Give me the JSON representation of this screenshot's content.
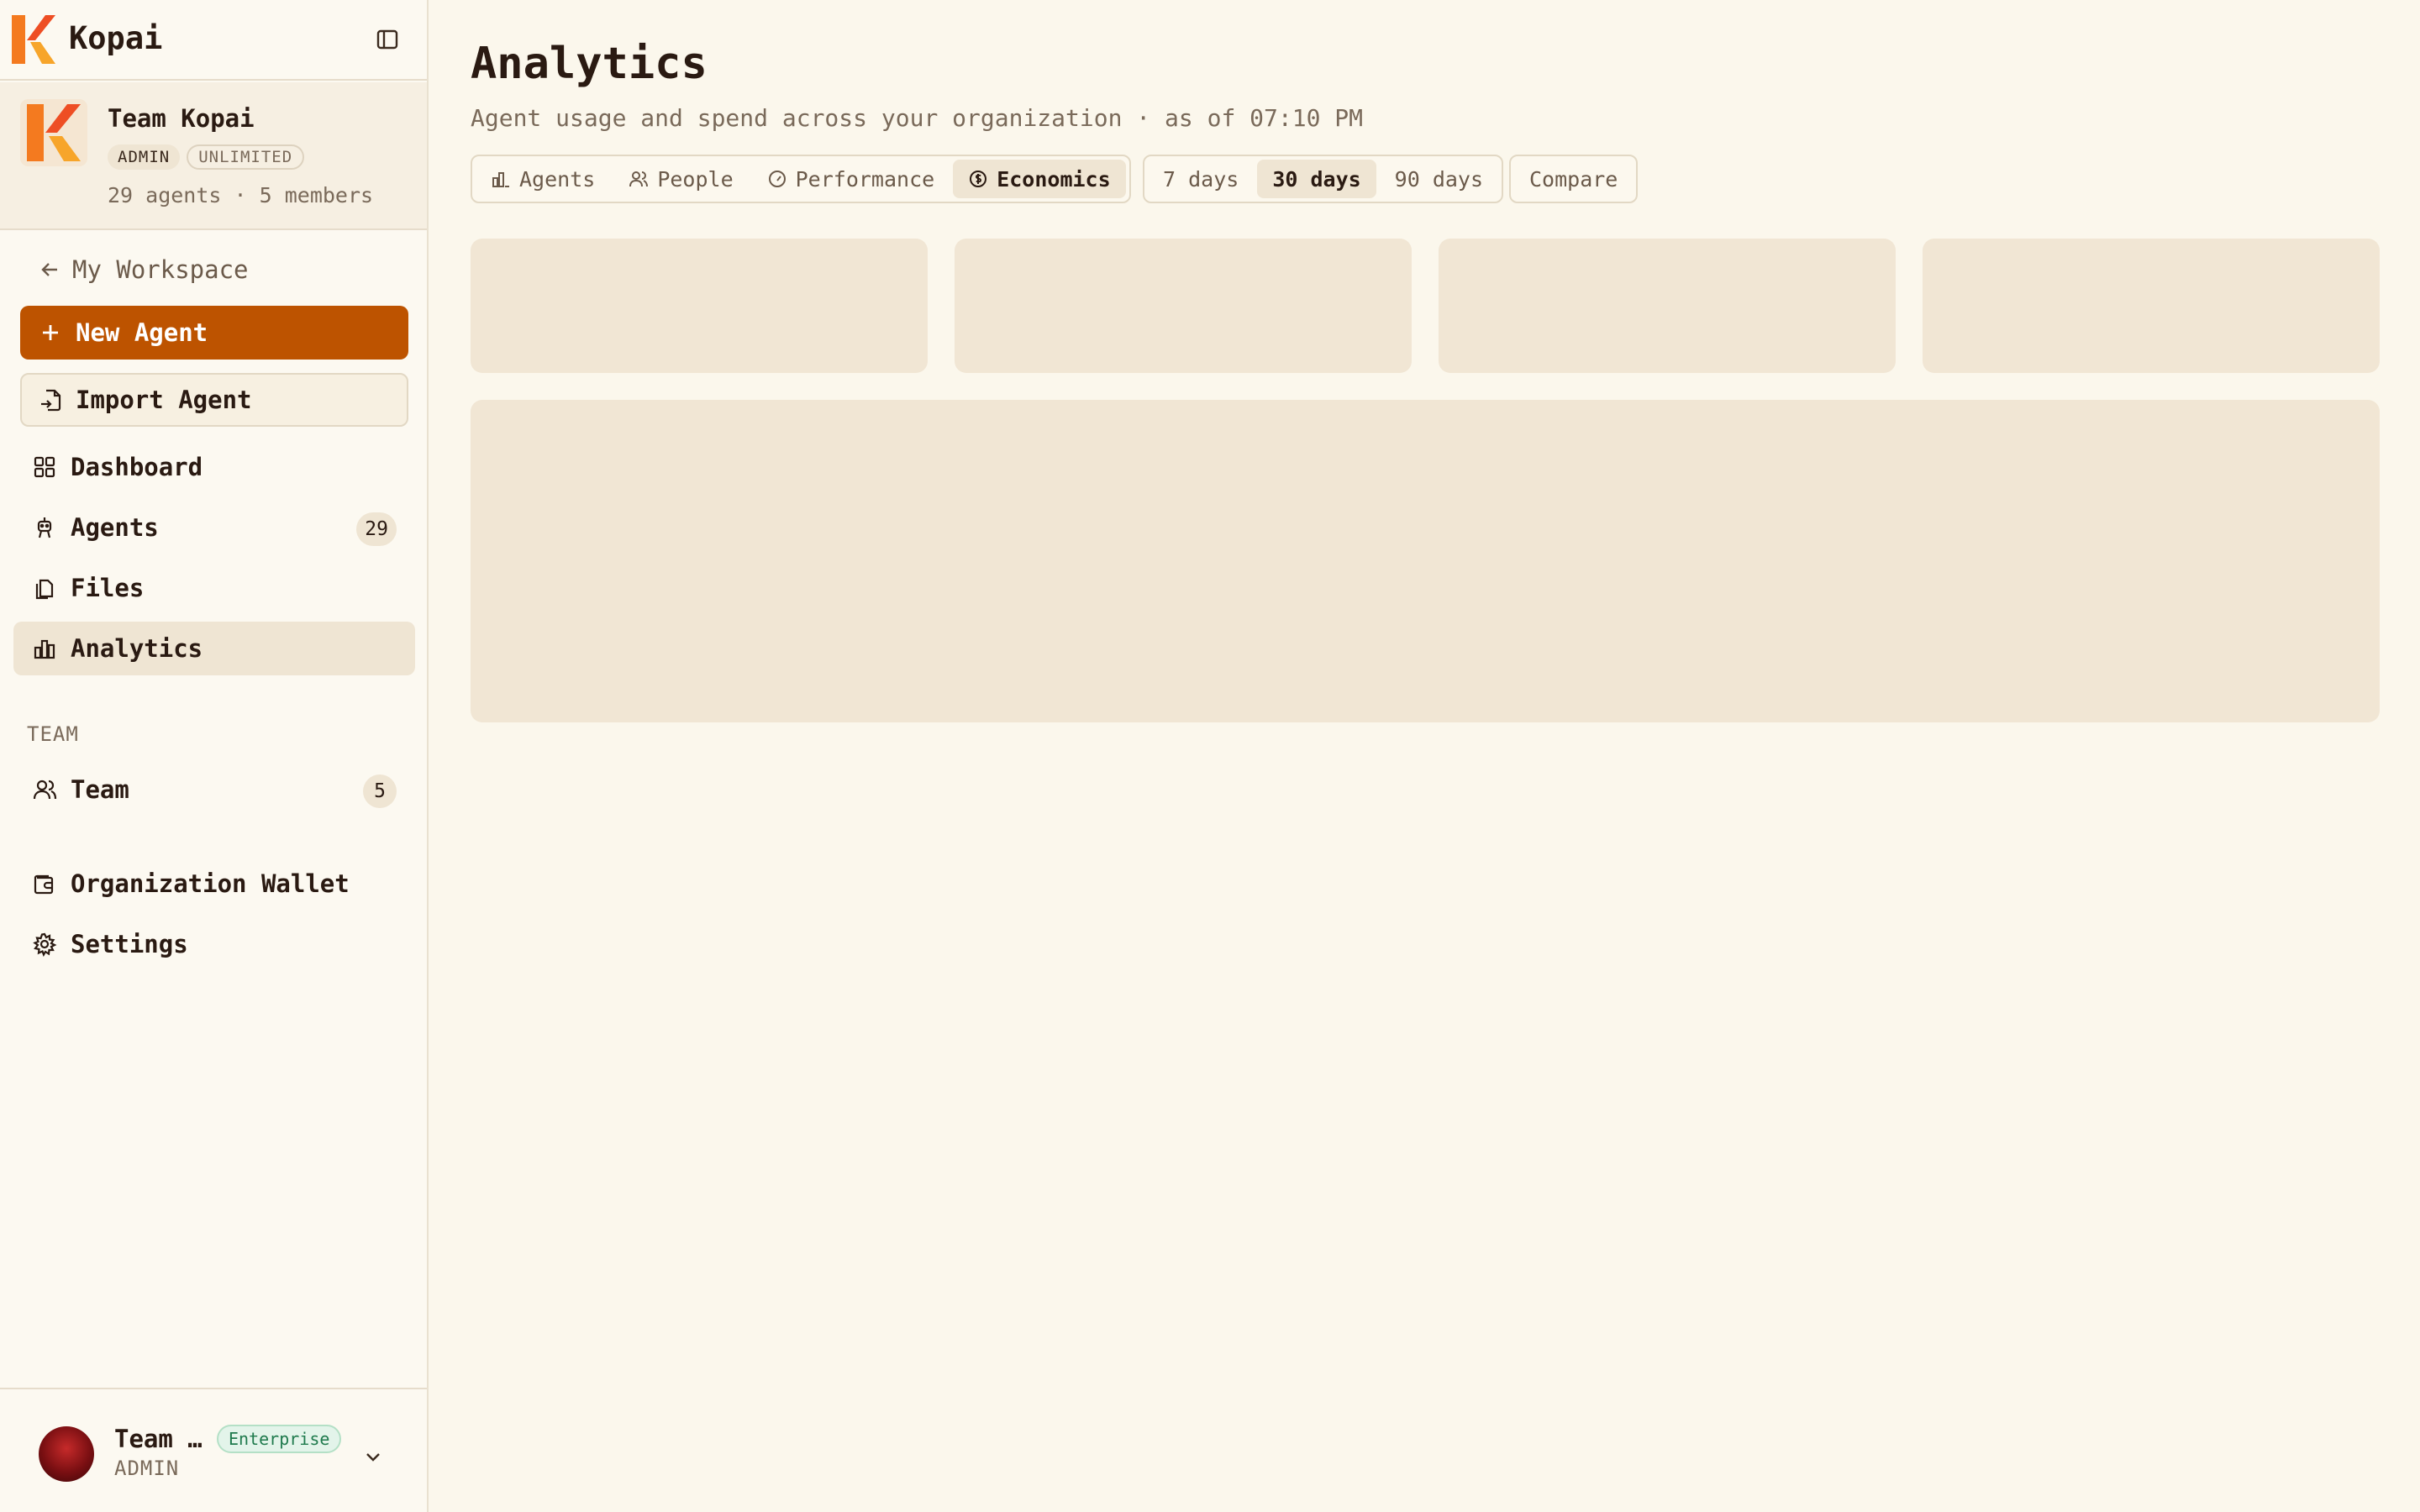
{
  "brand": {
    "name": "Kopai"
  },
  "team": {
    "name": "Team Kopai",
    "role_badge": "ADMIN",
    "plan_badge": "UNLIMITED",
    "meta": "29 agents · 5 members"
  },
  "sidebar": {
    "back_label": "My Workspace",
    "new_agent_label": "New Agent",
    "import_agent_label": "Import Agent",
    "nav": {
      "dashboard": "Dashboard",
      "agents": "Agents",
      "agents_count": "29",
      "files": "Files",
      "analytics": "Analytics"
    },
    "team_section_label": "TEAM",
    "team_item": "Team",
    "team_count": "5",
    "wallet": "Organization Wallet",
    "settings": "Settings"
  },
  "user": {
    "name": "Team …",
    "plan": "Enterprise",
    "role": "ADMIN"
  },
  "main": {
    "title": "Analytics",
    "subtitle": "Agent usage and spend across your organization · as of 07:10 PM",
    "view_tabs": [
      "Agents",
      "People",
      "Performance",
      "Economics"
    ],
    "active_view": "Economics",
    "ranges": [
      "7 days",
      "30 days",
      "90 days"
    ],
    "active_range": "30 days",
    "compare_label": "Compare"
  },
  "colors": {
    "accent": "#bd5300",
    "background": "#fbf7ec",
    "skeleton": "#f1e6d4",
    "active_nav": "#efe5d3"
  }
}
